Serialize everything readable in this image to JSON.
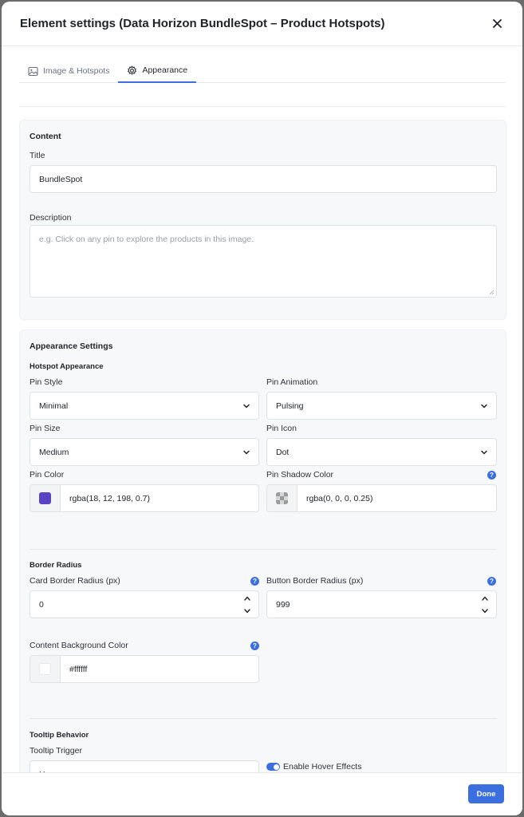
{
  "modal": {
    "title": "Element settings (Data Horizon BundleSpot – Product Hotspots)",
    "close_icon": "close-icon"
  },
  "tabs": [
    {
      "label": "Image & Hotspots",
      "icon": "image-icon",
      "active": false
    },
    {
      "label": "Appearance",
      "icon": "gear-icon",
      "active": true
    }
  ],
  "content": {
    "heading": "Content",
    "title_label": "Title",
    "title_value": "BundleSpot",
    "description_label": "Description",
    "description_placeholder": "e.g. Click on any pin to explore the products in this image."
  },
  "appearance": {
    "heading": "Appearance Settings",
    "hotspot_heading": "Hotspot Appearance",
    "pin_style_label": "Pin Style",
    "pin_style_value": "Minimal",
    "pin_animation_label": "Pin Animation",
    "pin_animation_value": "Pulsing",
    "pin_size_label": "Pin Size",
    "pin_size_value": "Medium",
    "pin_icon_label": "Pin Icon",
    "pin_icon_value": "Dot",
    "pin_color_label": "Pin Color",
    "pin_color_value": "rgba(18, 12, 198, 0.7)",
    "pin_shadow_label": "Pin Shadow Color",
    "pin_shadow_value": "rgba(0, 0, 0, 0.25)",
    "border_heading": "Border Radius",
    "card_radius_label": "Card Border Radius (px)",
    "card_radius_value": "0",
    "button_radius_label": "Button Border Radius (px)",
    "button_radius_value": "999",
    "content_bg_label": "Content Background Color",
    "content_bg_value": "#ffffff",
    "tooltip_heading": "Tooltip Behavior",
    "tooltip_trigger_label": "Tooltip Trigger",
    "tooltip_trigger_value": "Hover",
    "hover_effects_label": "Enable Hover Effects",
    "hover_effects_on": true,
    "help_glyph": "?"
  },
  "footer": {
    "done_label": "Done"
  },
  "colors": {
    "accent": "#3b6fe0",
    "pin_swatch": "#5a44c4",
    "content_bg_swatch": "#ffffff"
  }
}
